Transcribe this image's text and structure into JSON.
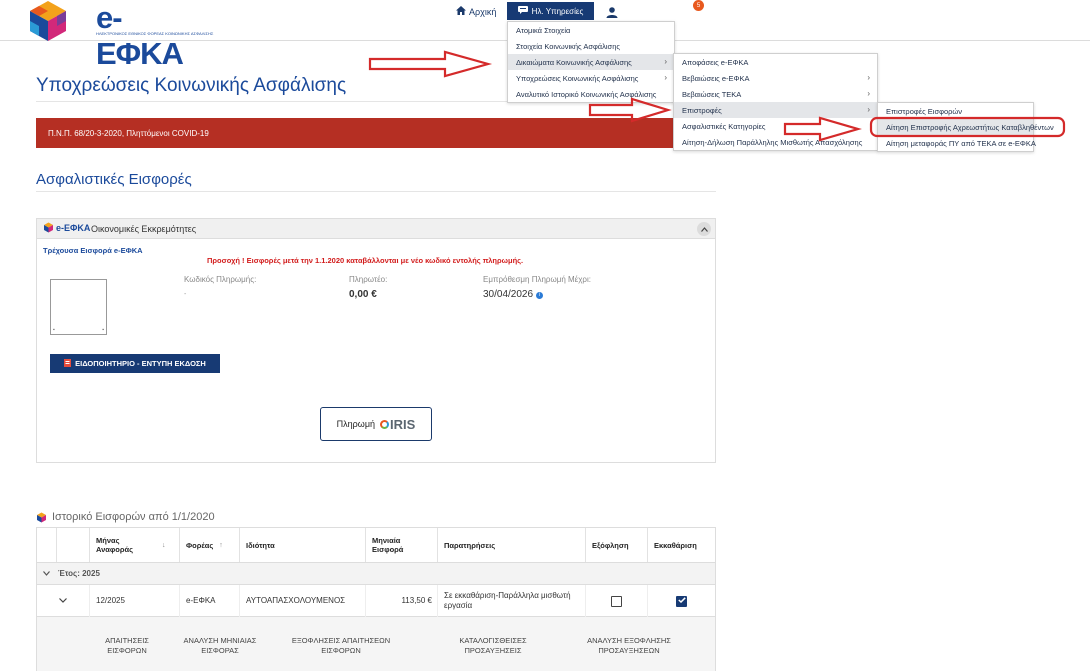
{
  "header": {
    "logo_text": "e-ΕΦΚΑ",
    "logo_sub": "ΗΛΕΚΤΡΟΝΙΚΟΣ ΕΘΝΙΚΟΣ ΦΟΡΕΑΣ ΚΟΙΝΩΝΙΚΗΣ ΑΣΦΑΛΙΣΗΣ",
    "nav_home": "Αρχική",
    "nav_services": "Ηλ. Υπηρεσίες",
    "notification_count": "5"
  },
  "menu1": {
    "items": [
      {
        "label": "Ατομικά Στοιχεία"
      },
      {
        "label": "Στοιχεία Κοινωνικής Ασφάλισης"
      },
      {
        "label": "Δικαιώματα Κοινωνικής Ασφάλισης"
      },
      {
        "label": "Υποχρεώσεις Κοινωνικής Ασφάλισης"
      },
      {
        "label": "Αναλυτικό Ιστορικό Κοινωνικής Ασφάλισης"
      }
    ]
  },
  "menu2": {
    "items": [
      {
        "label": "Αποφάσεις e-ΕΦΚΑ"
      },
      {
        "label": "Βεβαιώσεις e-ΕΦΚΑ"
      },
      {
        "label": "Βεβαιώσεις ΤΕΚΑ"
      },
      {
        "label": "Επιστροφές"
      },
      {
        "label": "Ασφαλιστικές Κατηγορίες"
      },
      {
        "label": "Αίτηση-Δήλωση Παράλληλης Μισθωτής Απασχόλησης"
      }
    ]
  },
  "menu3": {
    "items": [
      {
        "label": "Επιστροφές Εισφορών"
      },
      {
        "label": "Αίτηση Επιστροφής Αχρεωστήτως Καταβληθέντων"
      },
      {
        "label": "Αίτηση μεταφοράς ΠΥ από ΤΕΚΑ σε e-ΕΦΚΑ"
      }
    ]
  },
  "page": {
    "title": "Υποχρεώσεις Κοινωνικής Ασφάλισης",
    "alert": "Π.Ν.Π. 68/20-3-2020, Πληττόμενοι COVID-19",
    "section_title": "Ασφαλιστικές Εισφορές"
  },
  "panel": {
    "logo": "e-ΕΦΚΑ",
    "title": "Οικονομικές Εκκρεμότητες",
    "current_label": "Τρέχουσα Εισφορά e-ΕΦΚΑ",
    "warning": "Προσοχή ! Εισφορές μετά την 1.1.2020 καταβάλλονται με νέο κωδικό εντολής πληρωμής.",
    "payment_code_label": "Κωδικός Πληρωμής:",
    "payment_code_value": "-",
    "payable_label": "Πληρωτέο:",
    "payable_value": "0,00 €",
    "due_label": "Εμπρόθεσμη Πληρωμή Μέχρι:",
    "due_value": "30/04/2026",
    "print_button": "ΕΙΔΟΠΟΙΗΤΗΡΙΟ - ΕΝΤΥΠΗ ΕΚΔΟΣΗ",
    "pay_button": "Πληρωμή",
    "pay_provider": "IRIS"
  },
  "history": {
    "title": "Ιστορικό Εισφορών από 1/1/2020",
    "columns": {
      "month": "Μήνας Αναφοράς",
      "agency": "Φορέας",
      "capacity": "Ιδιότητα",
      "monthly": "Μηνιαία Εισφορά",
      "notes": "Παρατηρήσεις",
      "paid": "Εξόφληση",
      "cleared": "Εκκαθάριση"
    },
    "group_label": "Έτος: 2025",
    "row": {
      "month": "12/2025",
      "agency": "e-ΕΦΚΑ",
      "capacity": "ΑΥΤΟΑΠΑΣΧΟΛΟΥΜΕΝΟΣ",
      "monthly": "113,50 €",
      "notes": "Σε εκκαθάριση-Παράλληλα μισθωτή εργασία",
      "paid": false,
      "cleared": true
    },
    "sub_tabs": [
      {
        "label": "ΑΠΑΙΤΗΣΕΙΣ ΕΙΣΦΟΡΩΝ"
      },
      {
        "label": "ΑΝΑΛΥΣΗ ΜΗΝΙΑΙΑΣ ΕΙΣΦΟΡΑΣ"
      },
      {
        "label": "ΕΞΟΦΛΗΣΕΙΣ ΑΠΑΙΤΗΣΕΩΝ ΕΙΣΦΟΡΩΝ"
      },
      {
        "label": "ΚΑΤΑΛΟΓΙΣΘΕΙΣΕΣ ΠΡΟΣΑΥΞΗΣΕΙΣ"
      },
      {
        "label": "ΑΝΑΛΥΣΗ ΕΞΟΦΛΗΣΗΣ ΠΡΟΣΑΥΞΗΣΕΩΝ"
      }
    ]
  },
  "colors": {
    "brand": "#1b4a9b",
    "nav_dark": "#173a74",
    "alert": "#b52f23",
    "annotation": "#d42a2a"
  }
}
